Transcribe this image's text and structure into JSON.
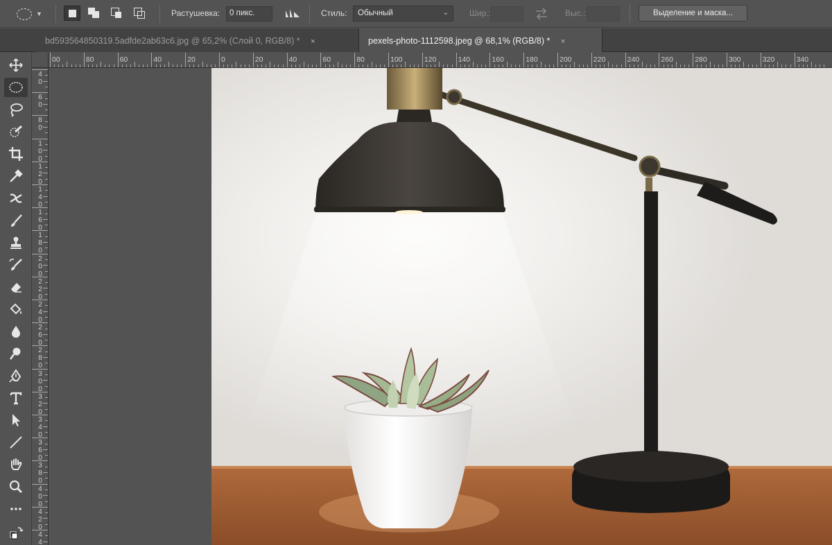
{
  "options": {
    "feather_label": "Растушевка:",
    "feather_value": "0 пикс.",
    "style_label": "Стиль:",
    "style_value": "Обычный",
    "width_label": "Шир.:",
    "height_label": "Выс.:",
    "select_mask_label": "Выделение и маска..."
  },
  "tabs": [
    {
      "label": "bd593564850319.5adfde2ab63c6.jpg @ 65,2% (Слой 0, RGB/8) *",
      "close": "×",
      "active": false
    },
    {
      "label": "pexels-photo-1112598.jpeg @ 68,1% (RGB/8) *",
      "close": "×",
      "active": true
    }
  ],
  "ruler": {
    "h_labels": [
      "00",
      "80",
      "60",
      "40",
      "20",
      "0",
      "20",
      "40",
      "60",
      "80",
      "100",
      "120",
      "140",
      "160",
      "180",
      "200",
      "220",
      "240",
      "260",
      "280",
      "300",
      "320",
      "340"
    ],
    "v_labels": [
      "40",
      "60",
      "80",
      "100",
      "120",
      "140",
      "160",
      "180",
      "200",
      "220",
      "240",
      "260",
      "280",
      "300",
      "320",
      "340",
      "360",
      "380",
      "400",
      "420",
      "440",
      "460",
      "480",
      "500"
    ]
  },
  "tools": [
    {
      "name": "move-tool",
      "active": false
    },
    {
      "name": "elliptical-marquee-tool",
      "active": true
    },
    {
      "name": "lasso-tool",
      "active": false
    },
    {
      "name": "quick-selection-tool",
      "active": false
    },
    {
      "name": "crop-tool",
      "active": false
    },
    {
      "name": "eyedropper-tool",
      "active": false
    },
    {
      "name": "healing-brush-tool",
      "active": false
    },
    {
      "name": "brush-tool",
      "active": false
    },
    {
      "name": "clone-stamp-tool",
      "active": false
    },
    {
      "name": "history-brush-tool",
      "active": false
    },
    {
      "name": "eraser-tool",
      "active": false
    },
    {
      "name": "paint-bucket-tool",
      "active": false
    },
    {
      "name": "blur-tool",
      "active": false
    },
    {
      "name": "dodge-tool",
      "active": false
    },
    {
      "name": "pen-tool",
      "active": false
    },
    {
      "name": "type-tool",
      "active": false
    },
    {
      "name": "path-selection-tool",
      "active": false
    },
    {
      "name": "line-tool",
      "active": false
    },
    {
      "name": "hand-tool",
      "active": false
    },
    {
      "name": "zoom-tool",
      "active": false
    },
    {
      "name": "more-tools",
      "active": false
    },
    {
      "name": "default-colors",
      "active": false
    }
  ]
}
